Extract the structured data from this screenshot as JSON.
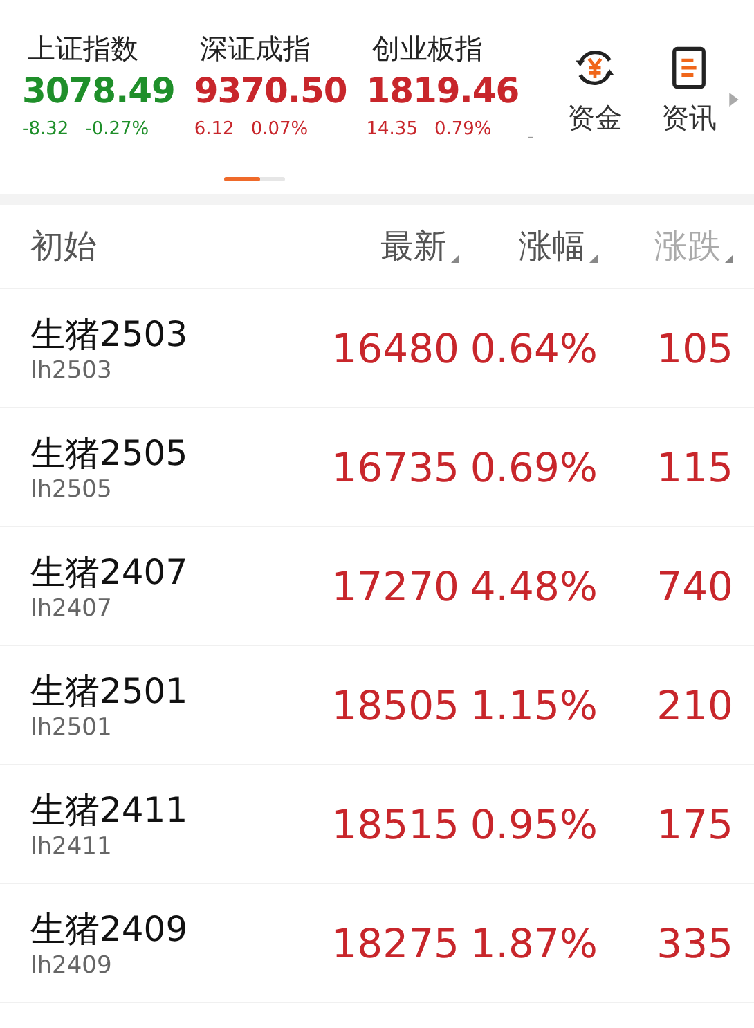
{
  "indices": [
    {
      "name": "上证指数",
      "value": "3078.49",
      "change": "-8.32",
      "percent": "-0.27%",
      "rising": false
    },
    {
      "name": "深证成指",
      "value": "9370.50",
      "change": "6.12",
      "percent": "0.07%",
      "rising": true
    },
    {
      "name": "创业板指",
      "value": "1819.46",
      "change": "14.35",
      "percent": "0.79%",
      "rising": true
    }
  ],
  "index_tail": "-",
  "shortcuts": [
    {
      "label": "资金",
      "kind": "fund"
    },
    {
      "label": "资讯",
      "kind": "news"
    }
  ],
  "table": {
    "columns": [
      {
        "label": "初始",
        "sortable": false,
        "faded": false
      },
      {
        "label": "最新",
        "sortable": true,
        "faded": false
      },
      {
        "label": "涨幅",
        "sortable": true,
        "faded": false
      },
      {
        "label": "涨跌",
        "sortable": true,
        "faded": true
      }
    ],
    "rows": [
      {
        "name": "生猪2503",
        "code": "lh2503",
        "last": "16480",
        "percent": "0.64%",
        "change": "105",
        "rising": true
      },
      {
        "name": "生猪2505",
        "code": "lh2505",
        "last": "16735",
        "percent": "0.69%",
        "change": "115",
        "rising": true
      },
      {
        "name": "生猪2407",
        "code": "lh2407",
        "last": "17270",
        "percent": "4.48%",
        "change": "740",
        "rising": true
      },
      {
        "name": "生猪2501",
        "code": "lh2501",
        "last": "18505",
        "percent": "1.15%",
        "change": "210",
        "rising": true
      },
      {
        "name": "生猪2411",
        "code": "lh2411",
        "last": "18515",
        "percent": "0.95%",
        "change": "175",
        "rising": true
      },
      {
        "name": "生猪2409",
        "code": "lh2409",
        "last": "18275",
        "percent": "1.87%",
        "change": "335",
        "rising": true
      }
    ]
  }
}
